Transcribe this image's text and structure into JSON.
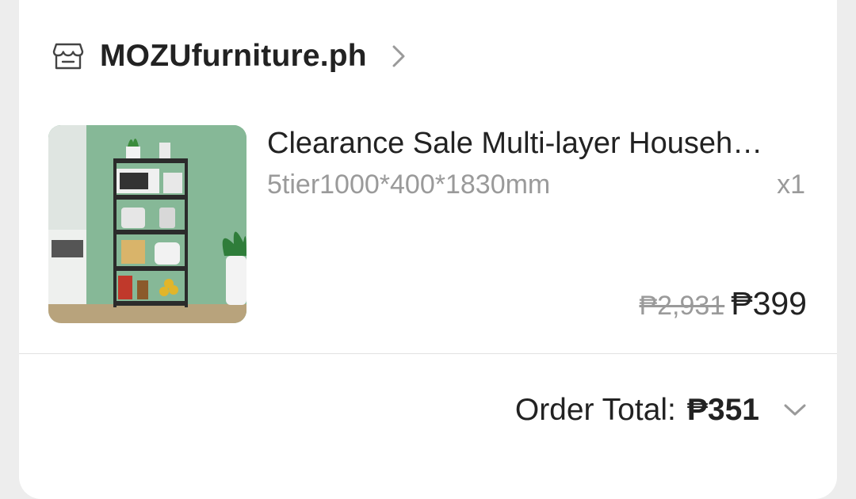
{
  "shop": {
    "icon": "store-icon",
    "name": "MOZUfurniture.ph",
    "chevron_icon": "chevron-right-icon"
  },
  "product": {
    "image_subject": "product-image",
    "title": "Clearance Sale Multi-layer Househ…",
    "variant": "5tier1000*400*1830mm",
    "quantity": "x1",
    "price_original": "₱2,931",
    "price_current": "₱399"
  },
  "order": {
    "total_label": "Order Total:",
    "total_value": "₱351",
    "expand_icon": "chevron-down-icon"
  },
  "colors": {
    "text_primary": "#222222",
    "text_secondary": "#9a9a9a",
    "card_bg": "#ffffff",
    "page_bg": "#ededed"
  }
}
